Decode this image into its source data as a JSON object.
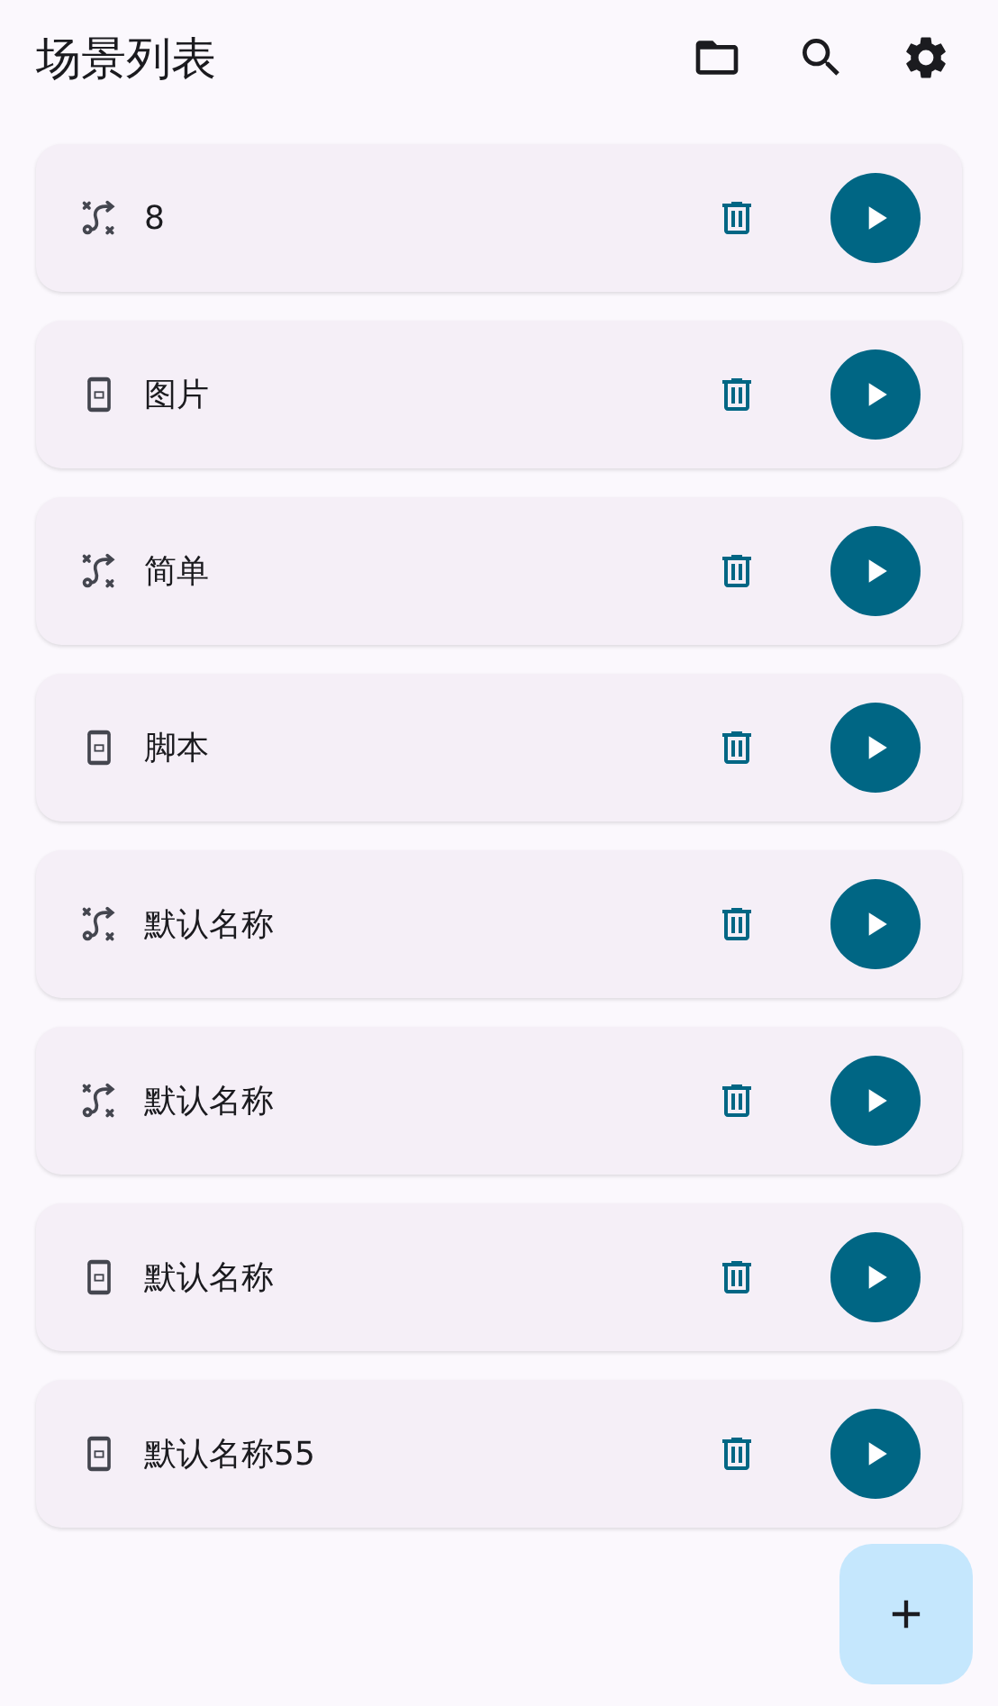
{
  "app_bar": {
    "title": "场景列表"
  },
  "scenes": [
    {
      "kind": "route",
      "name": "8"
    },
    {
      "kind": "device",
      "name": "图片"
    },
    {
      "kind": "route",
      "name": "简单"
    },
    {
      "kind": "device",
      "name": "脚本"
    },
    {
      "kind": "route",
      "name": "默认名称"
    },
    {
      "kind": "route",
      "name": "默认名称"
    },
    {
      "kind": "device",
      "name": "默认名称"
    },
    {
      "kind": "device",
      "name": "默认名称55"
    }
  ]
}
